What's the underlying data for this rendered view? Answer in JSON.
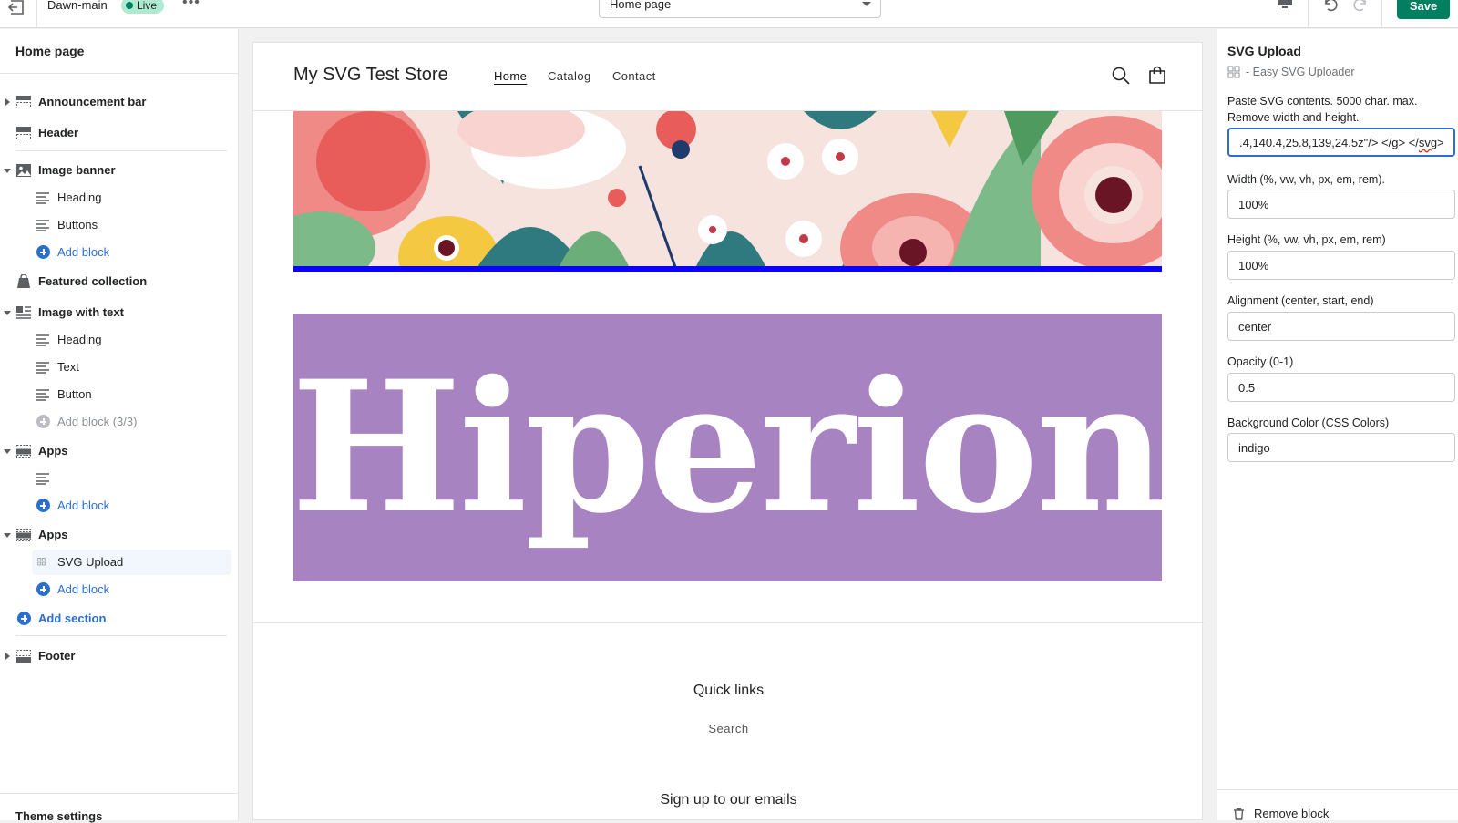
{
  "topbar": {
    "theme_name": "Dawn-main",
    "live_badge": "Live",
    "more_label": "•••",
    "page_select": "Home page",
    "save_label": "Save"
  },
  "sidebar": {
    "title": "Home page",
    "items": [
      {
        "label": "Announcement bar"
      },
      {
        "label": "Header"
      },
      {
        "label": "Image banner"
      },
      {
        "label": "Heading"
      },
      {
        "label": "Buttons"
      },
      {
        "label": "Add block"
      },
      {
        "label": "Featured collection"
      },
      {
        "label": "Image with text"
      },
      {
        "label": "Heading"
      },
      {
        "label": "Text"
      },
      {
        "label": "Button"
      },
      {
        "label": "Add block (3/3)"
      },
      {
        "label": "Apps"
      },
      {
        "label": "Add block"
      },
      {
        "label": "Apps"
      },
      {
        "label": "SVG Upload"
      },
      {
        "label": "Add block"
      },
      {
        "label": "Add section"
      },
      {
        "label": "Footer"
      }
    ],
    "theme_settings": "Theme settings"
  },
  "store": {
    "name": "My SVG Test Store",
    "nav": [
      "Home",
      "Catalog",
      "Contact"
    ],
    "svg_text": "Hiperion",
    "quick_links_title": "Quick links",
    "quick_links": [
      "Search"
    ],
    "signup_title": "Sign up to our emails"
  },
  "panel": {
    "title": "SVG Upload",
    "app_name": "- Easy SVG Uploader",
    "fields": [
      {
        "label": "Paste SVG contents. 5000 char. max. Remove width and height.",
        "value_prefix": ".4,140.4,25.8,139,24.5z\"/> </g> </",
        "value_squiggle": "svg",
        "value_suffix": ">"
      },
      {
        "label": "Width (%, vw, vh, px, em, rem).",
        "value": "100%"
      },
      {
        "label": "Height (%, vw, vh, px, em, rem)",
        "value": "100%"
      },
      {
        "label": "Alignment (center, start, end)",
        "value": "center"
      },
      {
        "label": "Opacity (0-1)",
        "value": "0.5"
      },
      {
        "label": "Background Color (CSS Colors)",
        "value": "indigo"
      }
    ],
    "remove_label": "Remove block"
  },
  "colors": {
    "accent": "#2c6ecb",
    "save": "#008060",
    "svg_bg": "#a783c2",
    "banner_rule": "#0a00ff"
  },
  "icons": [
    "exit-icon",
    "more-icon",
    "desktop-icon",
    "undo-icon",
    "redo-icon",
    "section-icon",
    "image-icon",
    "text-block-icon",
    "plus-circle-icon",
    "tag-icon",
    "app-block-icon",
    "search-icon",
    "cart-icon",
    "trash-icon"
  ]
}
